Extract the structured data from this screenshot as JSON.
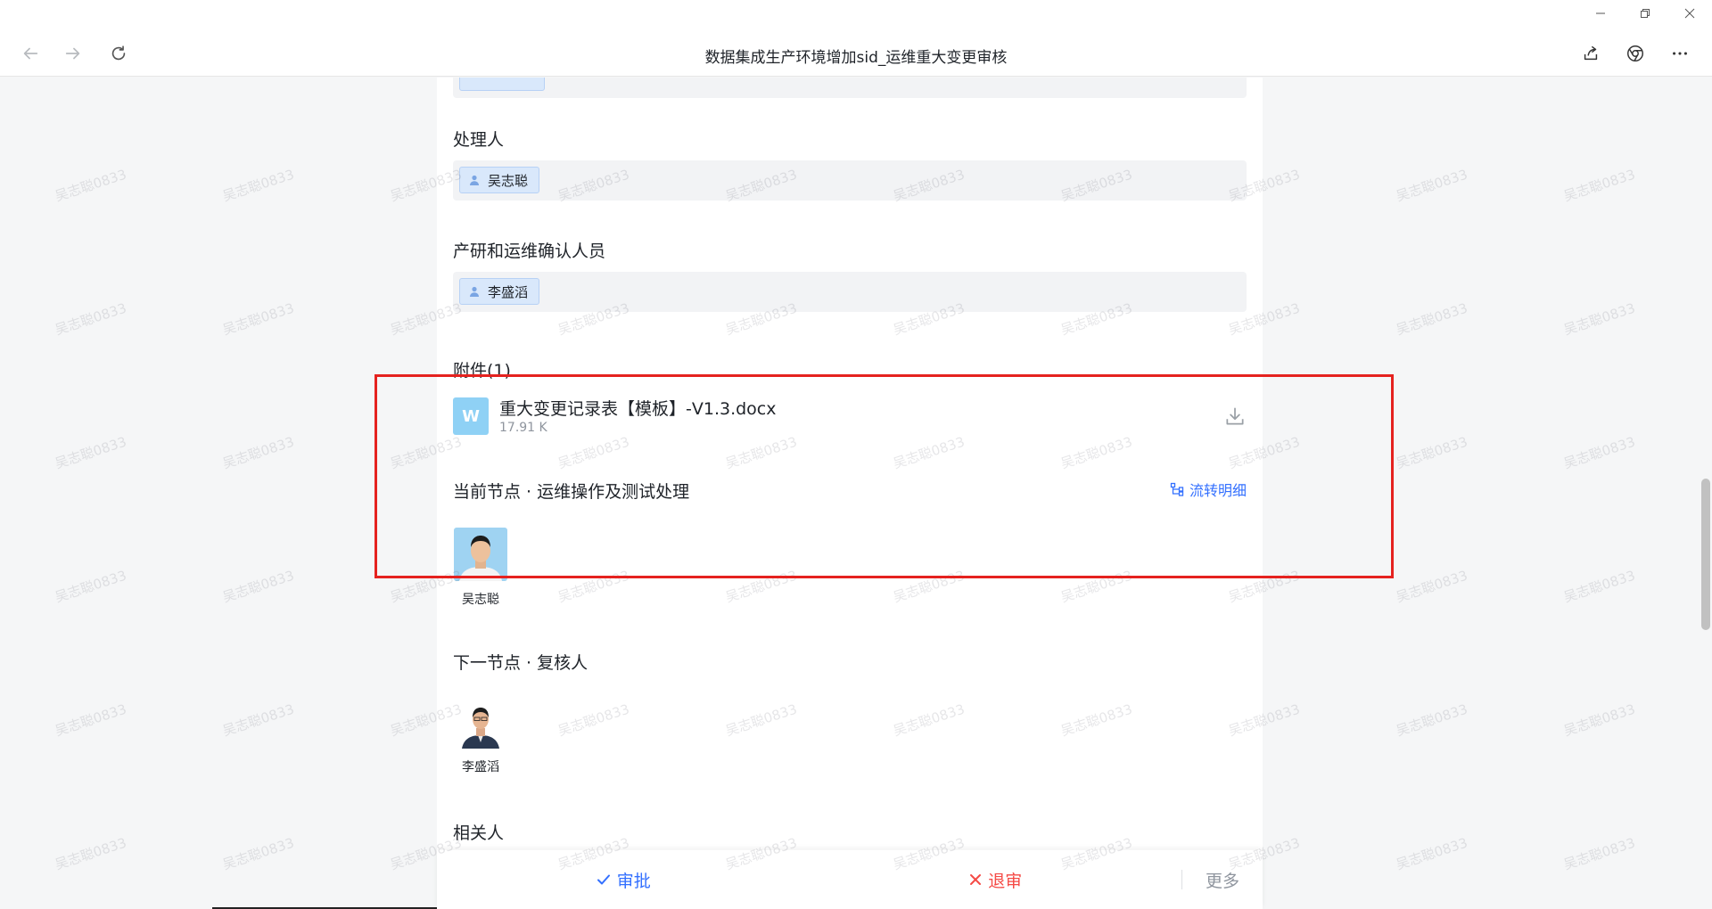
{
  "window": {
    "title": "数据集成生产环境增加sid_运维重大变更审核",
    "minimize_icon": "minimize-icon",
    "restore_icon": "restore-icon",
    "close_icon": "close-icon"
  },
  "form": {
    "handler": {
      "label": "处理人",
      "people": [
        "吴志聪"
      ]
    },
    "confirmers": {
      "label": "产研和运维确认人员",
      "people": [
        "李盛滔"
      ]
    },
    "attachments": {
      "label": "附件(1)",
      "files": [
        {
          "name": "重大变更记录表【模板】-V1.3.docx",
          "size": "17.91 K",
          "icon_letter": "W"
        }
      ]
    }
  },
  "current_node": {
    "title": "当前节点 · 运维操作及测试处理",
    "flow_link": "流转明细",
    "person": "吴志聪"
  },
  "next_node": {
    "title": "下一节点 · 复核人",
    "person": "李盛滔"
  },
  "related": {
    "label": "相关人"
  },
  "actions": {
    "approve": "审批",
    "reject": "退审",
    "more": "更多"
  },
  "watermark": "吴志聪0833",
  "colors": {
    "accent": "#3370ff",
    "reject": "#f54a45",
    "highlight": "#e5221f",
    "chip_bg": "#d9e8fb"
  }
}
